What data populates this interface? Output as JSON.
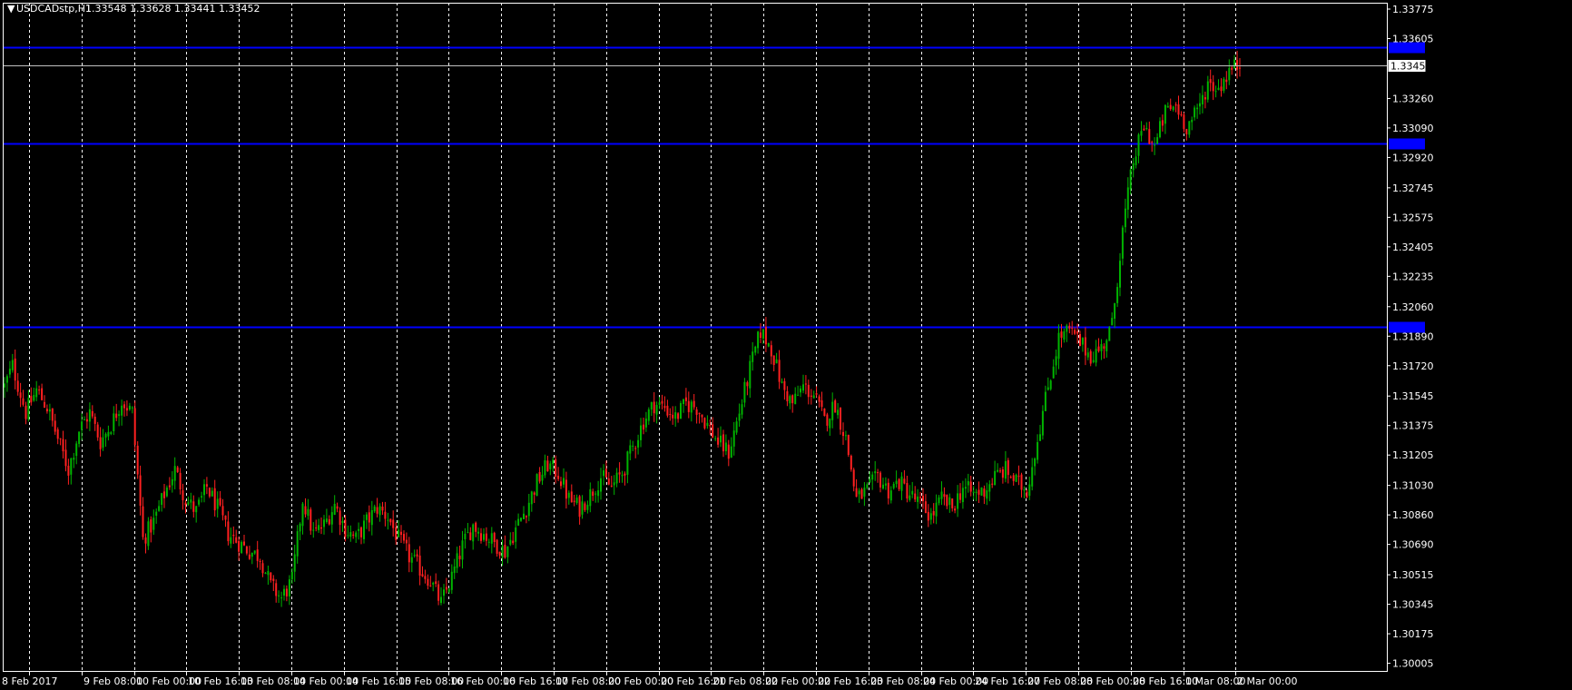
{
  "header": {
    "symbol": "USDCADstp,H1",
    "ohlc": "1.33548 1.33628 1.33441 1.33452"
  },
  "colors": {
    "background": "#000000",
    "bull": "#00b400",
    "bear": "#ff2020",
    "grid": "#ffffff",
    "hline": "#0000ff",
    "bid_line": "#c0c0c0"
  },
  "chart_data": {
    "type": "candlestick",
    "timeframe": "H1",
    "ylim": [
      1.30055,
      1.33775
    ],
    "y_ticks": [
      "1.33775",
      "1.33605",
      "1.33260",
      "1.33090",
      "1.32920",
      "1.32745",
      "1.32575",
      "1.32405",
      "1.32235",
      "1.32060",
      "1.31890",
      "1.31720",
      "1.31545",
      "1.31375",
      "1.31205",
      "1.31030",
      "1.30860",
      "1.30690",
      "1.30515",
      "1.30345",
      "1.30175",
      "1.30005"
    ],
    "x_ticks": [
      "8 Feb 2017",
      "9 Feb 08:00",
      "10 Feb 00:00",
      "10 Feb 16:00",
      "13 Feb 08:00",
      "14 Feb 00:00",
      "14 Feb 16:00",
      "15 Feb 08:00",
      "16 Feb 00:00",
      "16 Feb 16:00",
      "17 Feb 08:00",
      "20 Feb 00:00",
      "20 Feb 16:00",
      "21 Feb 08:00",
      "22 Feb 00:00",
      "22 Feb 16:00",
      "23 Feb 08:00",
      "24 Feb 00:00",
      "24 Feb 16:00",
      "27 Feb 08:00",
      "28 Feb 00:00",
      "28 Feb 16:00",
      "1 Mar 08:00",
      "2 Mar 00:00"
    ],
    "bid_price": "1.33452",
    "horizontal_lines": [
      1.33555,
      1.32999,
      1.31945
    ],
    "anchors": [
      [
        0,
        1.316
      ],
      [
        3,
        1.3172
      ],
      [
        8,
        1.3145
      ],
      [
        12,
        1.3158
      ],
      [
        16,
        1.3148
      ],
      [
        20,
        1.313
      ],
      [
        24,
        1.3112
      ],
      [
        28,
        1.3135
      ],
      [
        32,
        1.3145
      ],
      [
        36,
        1.3128
      ],
      [
        40,
        1.3138
      ],
      [
        44,
        1.3152
      ],
      [
        48,
        1.3145
      ],
      [
        52,
        1.3072
      ],
      [
        56,
        1.3082
      ],
      [
        60,
        1.3098
      ],
      [
        64,
        1.3112
      ],
      [
        68,
        1.3095
      ],
      [
        72,
        1.3088
      ],
      [
        76,
        1.3102
      ],
      [
        80,
        1.309
      ],
      [
        84,
        1.3075
      ],
      [
        88,
        1.307
      ],
      [
        92,
        1.3065
      ],
      [
        96,
        1.3062
      ],
      [
        100,
        1.3045
      ],
      [
        104,
        1.3038
      ],
      [
        108,
        1.3048
      ],
      [
        112,
        1.3095
      ],
      [
        116,
        1.3075
      ],
      [
        120,
        1.308
      ],
      [
        124,
        1.3092
      ],
      [
        128,
        1.3078
      ],
      [
        132,
        1.3072
      ],
      [
        136,
        1.3082
      ],
      [
        140,
        1.309
      ],
      [
        144,
        1.3085
      ],
      [
        148,
        1.3072
      ],
      [
        152,
        1.3062
      ],
      [
        156,
        1.3055
      ],
      [
        160,
        1.3048
      ],
      [
        164,
        1.3035
      ],
      [
        168,
        1.305
      ],
      [
        172,
        1.3068
      ],
      [
        176,
        1.308
      ],
      [
        180,
        1.3075
      ],
      [
        184,
        1.307
      ],
      [
        188,
        1.3065
      ],
      [
        192,
        1.3078
      ],
      [
        196,
        1.309
      ],
      [
        200,
        1.3105
      ],
      [
        204,
        1.3115
      ],
      [
        208,
        1.311
      ],
      [
        212,
        1.3095
      ],
      [
        216,
        1.309
      ],
      [
        220,
        1.3098
      ],
      [
        224,
        1.3108
      ],
      [
        228,
        1.3102
      ],
      [
        232,
        1.311
      ],
      [
        236,
        1.3125
      ],
      [
        240,
        1.314
      ],
      [
        244,
        1.315
      ],
      [
        248,
        1.3148
      ],
      [
        252,
        1.3142
      ],
      [
        256,
        1.315
      ],
      [
        260,
        1.3148
      ],
      [
        264,
        1.3138
      ],
      [
        268,
        1.3128
      ],
      [
        272,
        1.3122
      ],
      [
        276,
        1.3145
      ],
      [
        280,
        1.317
      ],
      [
        284,
        1.3192
      ],
      [
        288,
        1.3182
      ],
      [
        292,
        1.316
      ],
      [
        296,
        1.315
      ],
      [
        300,
        1.316
      ],
      [
        304,
        1.3155
      ],
      [
        308,
        1.314
      ],
      [
        312,
        1.315
      ],
      [
        316,
        1.313
      ],
      [
        320,
        1.3095
      ],
      [
        324,
        1.31
      ],
      [
        328,
        1.3108
      ],
      [
        332,
        1.31
      ],
      [
        336,
        1.3105
      ],
      [
        340,
        1.3098
      ],
      [
        344,
        1.3092
      ],
      [
        348,
        1.3085
      ],
      [
        352,
        1.3095
      ],
      [
        356,
        1.309
      ],
      [
        360,
        1.3102
      ],
      [
        364,
        1.3098
      ],
      [
        368,
        1.31
      ],
      [
        372,
        1.3108
      ],
      [
        376,
        1.3112
      ],
      [
        380,
        1.3105
      ],
      [
        384,
        1.31
      ],
      [
        388,
        1.313
      ],
      [
        392,
        1.316
      ],
      [
        396,
        1.3188
      ],
      [
        400,
        1.3192
      ],
      [
        404,
        1.3185
      ],
      [
        408,
        1.3178
      ],
      [
        412,
        1.3182
      ],
      [
        416,
        1.3195
      ],
      [
        420,
        1.325
      ],
      [
        424,
        1.329
      ],
      [
        428,
        1.331
      ],
      [
        432,
        1.3298
      ],
      [
        436,
        1.3318
      ],
      [
        440,
        1.3322
      ],
      [
        444,
        1.331
      ],
      [
        448,
        1.3318
      ],
      [
        452,
        1.3335
      ],
      [
        456,
        1.3332
      ],
      [
        460,
        1.3342
      ],
      [
        464,
        1.3346
      ]
    ]
  }
}
